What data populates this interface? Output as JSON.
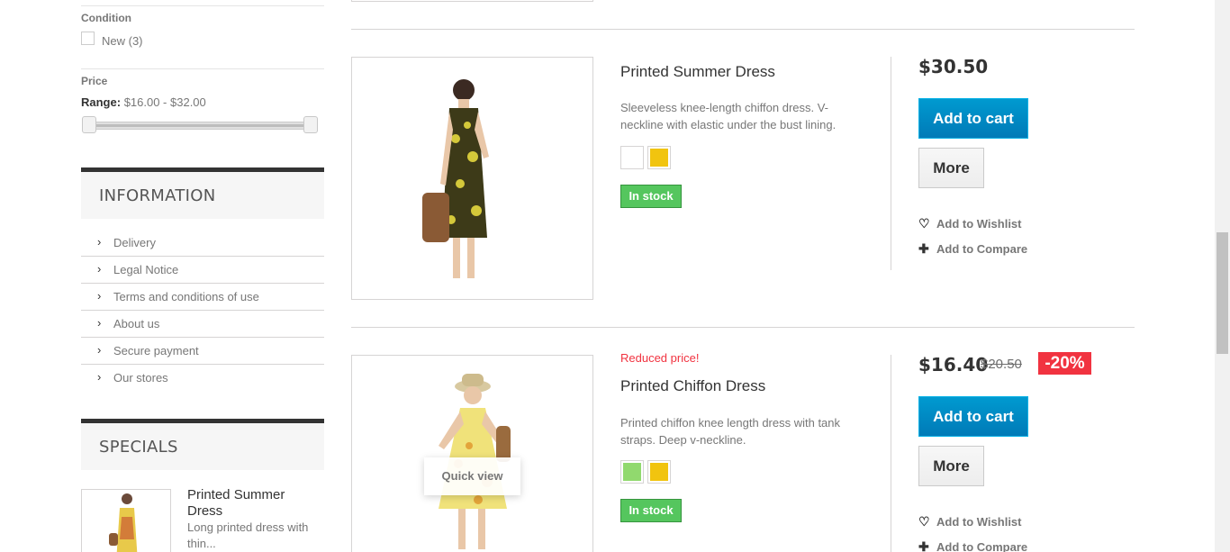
{
  "filters": {
    "condition": {
      "title": "Condition",
      "option_label": "New (3)"
    },
    "price": {
      "title": "Price",
      "range_label": "Range:",
      "range_value": "$16.00 - $32.00",
      "min": 16.0,
      "max": 32.0
    }
  },
  "information": {
    "title": "INFORMATION",
    "items": [
      "Delivery",
      "Legal Notice",
      "Terms and conditions of use",
      "About us",
      "Secure payment",
      "Our stores"
    ]
  },
  "specials": {
    "title": "SPECIALS",
    "item": {
      "name": "Printed Summer Dress",
      "desc": "Long printed dress with thin..."
    }
  },
  "products": [
    {
      "name": "Printed Summer Dress",
      "desc": "Sleeveless knee-length chiffon dress. V-neckline with elastic under the bust lining.",
      "swatches": [
        "#ffffff",
        "#f1c40f"
      ],
      "stock": "In stock",
      "price": "$30.50",
      "add_to_cart": "Add to cart",
      "more": "More",
      "wishlist": "Add to Wishlist",
      "compare": "Add to Compare"
    },
    {
      "reduced": "Reduced price!",
      "name": "Printed Chiffon Dress",
      "desc": "Printed chiffon knee length dress with tank straps. Deep v-neckline.",
      "swatches": [
        "#91d96e",
        "#f1c40f"
      ],
      "stock": "In stock",
      "price": "$16.40",
      "old_price": "$20.50",
      "discount": "-20%",
      "add_to_cart": "Add to cart",
      "more": "More",
      "wishlist": "Add to Wishlist",
      "compare": "Add to Compare",
      "quick_view": "Quick view"
    }
  ],
  "colors": {
    "accent_blue": "#0079b6",
    "stock_green": "#55c65e",
    "sale_red": "#f13340"
  }
}
